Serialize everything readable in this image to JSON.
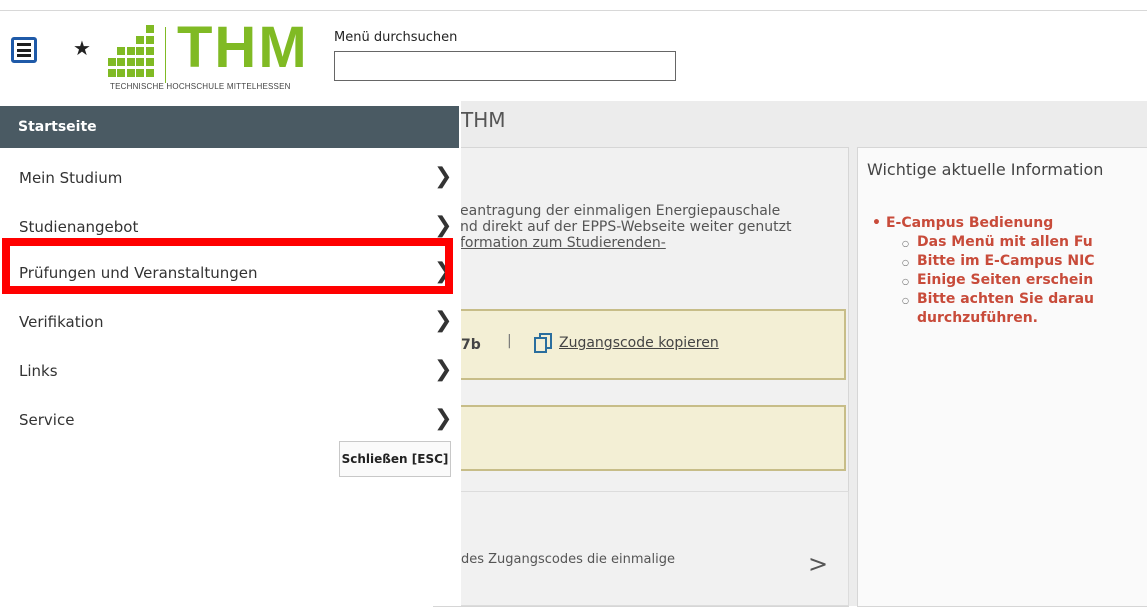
{
  "header": {
    "logo_text": "THM",
    "logo_subtitle": "TECHNISCHE HOCHSCHULE MITTELHESSEN",
    "search_label": "Menü durchsuchen",
    "search_value": ""
  },
  "main": {
    "page_title": "THM",
    "card_text": {
      "line1": "eantragung der einmaligen Energiepauschale",
      "line2": "nd direkt auf der EPPS-Webseite weiter genutzt",
      "line3": "formation zum Studierenden-"
    },
    "code_suffix": "7b",
    "code_divider": "|",
    "copy_link": "Zugangscode kopieren",
    "lower_text": "des Zugangscodes die einmalige",
    "info": {
      "title": "Wichtige aktuelle Information",
      "top_item": "E-Campus Bedienung",
      "sub_items": [
        "Das Menü mit allen Fu",
        "Bitte im E-Campus NIC",
        "Einige Seiten erschein",
        "Bitte achten Sie darau"
      ],
      "continuation": "durchzuführen."
    }
  },
  "drawer": {
    "header": "Startseite",
    "items": [
      {
        "label": "Mein Studium"
      },
      {
        "label": "Studienangebot"
      },
      {
        "label": "Prüfungen und Veranstaltungen"
      },
      {
        "label": "Verifikation"
      },
      {
        "label": "Links"
      },
      {
        "label": "Service"
      }
    ],
    "close_label": "Schließen [ESC]"
  },
  "colors": {
    "brand_green": "#80ba24",
    "drawer_header": "#4a5a63",
    "info_red": "#c84b3a",
    "highlight": "#ff0000"
  }
}
